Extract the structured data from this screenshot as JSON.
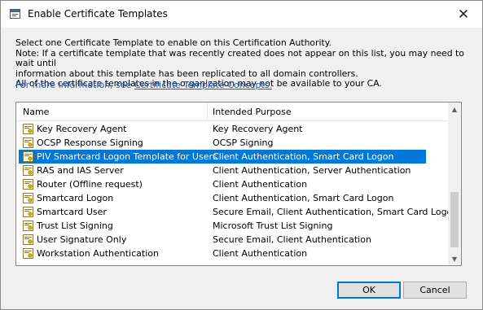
{
  "window": {
    "title": "Enable Certificate Templates",
    "close_glyph": "✕"
  },
  "intro": {
    "line1": "Select one Certificate Template to enable on this Certification Authority.",
    "line2": "Note: If a certificate template that was recently created does not appear on this list, you may need to wait until",
    "line3": "information about this template has been replicated to all domain controllers.",
    "line4": "All of the certificate templates in the organization may not be available to your CA.",
    "more_info_prefix": "For more information, see ",
    "more_info_link": "Certificate Template Concepts.",
    "link_color": "#2a5fb0"
  },
  "list": {
    "columns": {
      "name": "Name",
      "purpose": "Intended Purpose"
    },
    "rows": [
      {
        "name": "Key Recovery Agent",
        "purpose": "Key Recovery Agent",
        "icon": "certificate-template-icon"
      },
      {
        "name": "OCSP Response Signing",
        "purpose": "OCSP Signing",
        "icon": "certificate-template-icon"
      },
      {
        "name": "PIV Smartcard Logon Template for Users",
        "purpose": "Client Authentication, Smart Card Logon",
        "icon": "certificate-template-icon",
        "selected": true
      },
      {
        "name": "RAS and IAS Server",
        "purpose": "Client Authentication, Server Authentication",
        "icon": "certificate-template-icon"
      },
      {
        "name": "Router (Offline request)",
        "purpose": "Client Authentication",
        "icon": "certificate-template-icon"
      },
      {
        "name": "Smartcard Logon",
        "purpose": "Client Authentication, Smart Card Logon",
        "icon": "certificate-template-icon"
      },
      {
        "name": "Smartcard User",
        "purpose": "Secure Email, Client Authentication, Smart Card Logon",
        "icon": "certificate-template-icon"
      },
      {
        "name": "Trust List Signing",
        "purpose": "Microsoft Trust List Signing",
        "icon": "certificate-template-icon"
      },
      {
        "name": "User Signature Only",
        "purpose": "Secure Email, Client Authentication",
        "icon": "certificate-template-icon"
      },
      {
        "name": "Workstation Authentication",
        "purpose": "Client Authentication",
        "icon": "certificate-template-icon"
      }
    ],
    "selection_color": "#0078d7",
    "scroll_position": "bottom"
  },
  "buttons": {
    "ok": "OK",
    "cancel": "Cancel"
  }
}
